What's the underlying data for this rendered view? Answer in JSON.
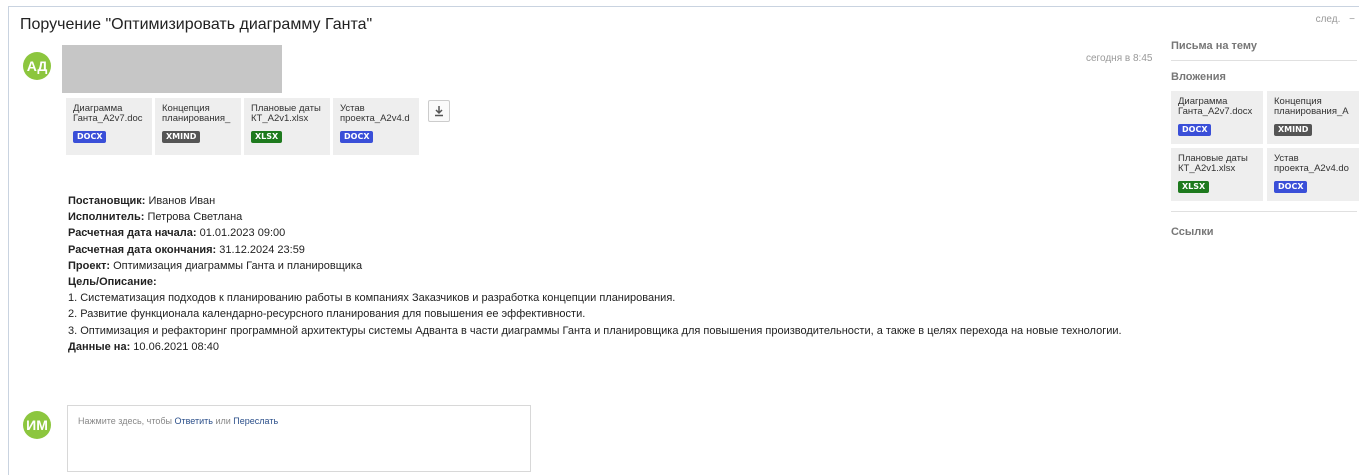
{
  "subject": "Поручение \"Оптимизировать диаграмму Ганта\"",
  "nav": {
    "next_label": "след.",
    "collapse_label": "−"
  },
  "message": {
    "avatar_initials": "АД",
    "timestamp": "сегодня в 8:45",
    "attachments": [
      {
        "name": "Диаграмма\nГанта_A2v7.doc",
        "type": "DOCX"
      },
      {
        "name": "Концепция\nпланирования_",
        "type": "XMIND"
      },
      {
        "name": "Плановые даты\nКТ_A2v1.xlsx",
        "type": "XLSX"
      },
      {
        "name": "Устав\nпроекта_A2v4.d",
        "type": "DOCX"
      }
    ],
    "fields": {
      "assigner_label": "Постановщик:",
      "assigner_value": " Иванов Иван",
      "executor_label": "Исполнитель:",
      "executor_value": " Петрова Светлана",
      "start_label": "Расчетная дата начала:",
      "start_value": " 01.01.2023 09:00",
      "end_label": "Расчетная дата окончания:",
      "end_value": " 31.12.2024 23:59",
      "project_label": "Проект:",
      "project_value": " Оптимизация диаграммы Ганта и планировщика",
      "goal_label": "Цель/Описание:",
      "goal_lines": [
        "1. Систематизация подходов к планированию работы в компаниях Заказчиков и разработка концепции планирования.",
        "2. Развитие функционала календарно-ресурсного планирования для повышения ее эффективности.",
        "3. Оптимизация и рефакторинг программной архитектуры системы Адванта в части диаграммы Ганта и планировщика для повышения производительности, а также в целях перехода на новые технологии."
      ],
      "data_label": "Данные на:",
      "data_value": " 10.06.2021 08:40"
    }
  },
  "reply": {
    "avatar_initials": "ИМ",
    "prefix": "Нажмите здесь, чтобы ",
    "reply_link": "Ответить",
    "middle": " или ",
    "forward_link": "Переслать"
  },
  "sidebar": {
    "thread_heading": "Письма на тему",
    "attachments_heading": "Вложения",
    "attachments": [
      {
        "name": "Диаграмма\nГанта_A2v7.docx",
        "type": "DOCX"
      },
      {
        "name": "Концепция\nпланирования_A",
        "type": "XMIND"
      },
      {
        "name": "Плановые даты\nКТ_A2v1.xlsx",
        "type": "XLSX"
      },
      {
        "name": "Устав\nпроекта_A2v4.do",
        "type": "DOCX"
      }
    ],
    "links_heading": "Ссылки"
  },
  "colors": {
    "avatar": "#8cc63e",
    "docx": "#3a4fd8",
    "xmind": "#555555",
    "xlsx": "#1e7a1e",
    "link": "#2b4f8a"
  }
}
